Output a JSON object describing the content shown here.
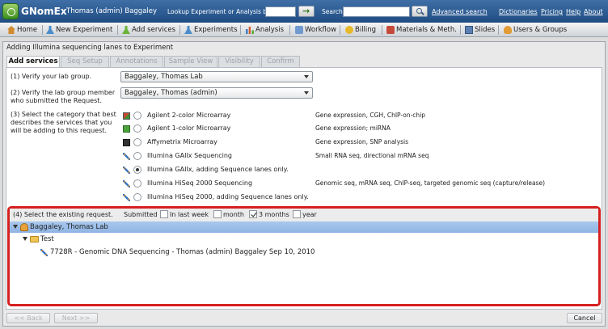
{
  "app": {
    "title": "GNomEx",
    "user": "Thomas (admin) Baggaley"
  },
  "topbar": {
    "lookup_label": "Lookup Experiment or Analysis by #",
    "lookup_value": "",
    "search_label": "Search",
    "search_value": "",
    "advanced_search": "Advanced search",
    "links": [
      "Dictionaries",
      "Pricing",
      "Help",
      "About"
    ]
  },
  "nav": {
    "items": [
      "Home",
      "New Experiment",
      "Add services",
      "Experiments",
      "Analysis",
      "Workflow",
      "Billing",
      "Materials & Meth.",
      "Slides",
      "Users & Groups"
    ]
  },
  "window": {
    "title": "Adding Illumina sequencing lanes to Experiment",
    "tabs": [
      "Add services",
      "Seq Setup",
      "Annotations",
      "Sample View",
      "Visibility",
      "Confirm"
    ],
    "active_tab": "Add services"
  },
  "form": {
    "step1": {
      "label": "(1) Verify your lab group.",
      "value": "Baggaley, Thomas Lab"
    },
    "step2": {
      "label_line1": "(2) Verify the lab group member",
      "label_line2": "who submitted the Request.",
      "value": "Baggaley, Thomas (admin)"
    },
    "step3": {
      "label_line1": "(3) Select the category that best",
      "label_line2": "describes the services that you",
      "label_line3": "will be adding to this request.",
      "categories": [
        {
          "label": "Agilent 2-color Microarray",
          "desc": "Gene expression, CGH, ChIP-on-chip",
          "icon": "agilent-2color-icon"
        },
        {
          "label": "Agilent 1-color Microarray",
          "desc": "Gene expression; miRNA",
          "icon": "agilent-1color-icon"
        },
        {
          "label": "Affymetrix Microarray",
          "desc": "Gene expression, SNP analysis",
          "icon": "affymetrix-icon"
        },
        {
          "label": "Illumina GAIIx Sequencing",
          "desc": "Small RNA seq, directional mRNA seq",
          "icon": "dna-icon"
        },
        {
          "label": "Illumina GAIIx, adding Sequence lanes only.",
          "desc": "",
          "icon": "dna-icon"
        },
        {
          "label": "Illumina HiSeq 2000 Sequencing",
          "desc": "Genomic seq, mRNA seq, ChIP-seq, targeted genomic seq (capture/release)",
          "icon": "dna-icon"
        },
        {
          "label": "Illumina HiSeq 2000, adding Sequence lanes only.",
          "desc": "",
          "icon": "dna-icon"
        }
      ],
      "selected_index": 4
    },
    "step4": {
      "label": "(4) Select the existing request.",
      "submitted_label": "Submitted",
      "filters": [
        {
          "label": "In last week",
          "checked": false
        },
        {
          "label": "month",
          "checked": false
        },
        {
          "label": "3 months",
          "checked": true
        },
        {
          "label": "year",
          "checked": false
        }
      ],
      "tree": {
        "lab": "Baggaley, Thomas Lab",
        "project": "Test",
        "request": "7728R - Genomic DNA Sequencing - Thomas (admin) Baggaley Sep 10, 2010"
      }
    }
  },
  "footer": {
    "back": "<< Back",
    "next": "Next >>",
    "cancel": "Cancel"
  }
}
